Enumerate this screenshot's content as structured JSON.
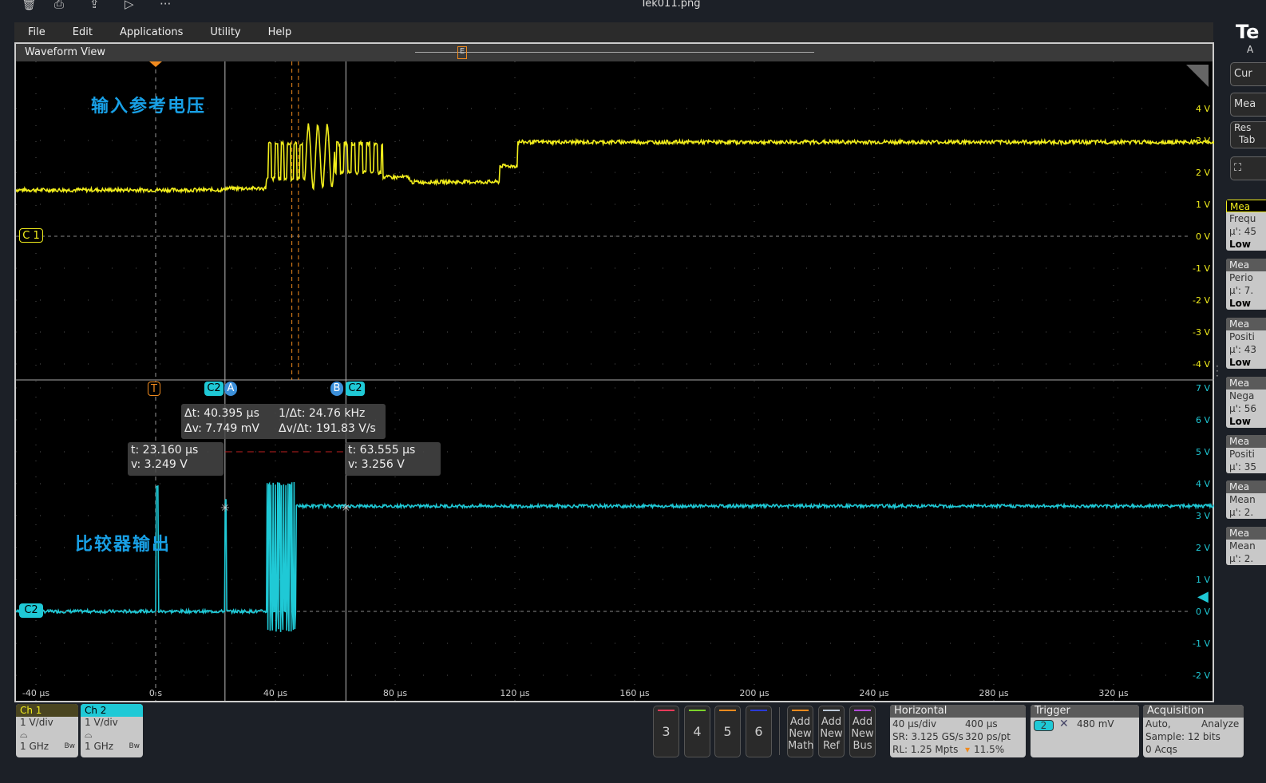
{
  "window": {
    "title": "Tek011.png",
    "toolbar_icons": [
      "trash-icon",
      "print-icon",
      "share-icon",
      "slideshow-icon",
      "more-icon"
    ]
  },
  "menu": [
    "File",
    "Edit",
    "Applications",
    "Utility",
    "Help"
  ],
  "waveform_view": {
    "title": "Waveform View",
    "upper_yticks": [
      "4 V",
      "3 V",
      "2 V",
      "1 V",
      "0 V",
      "-1 V",
      "-2 V",
      "-3 V",
      "-4 V"
    ],
    "lower_yticks": [
      "7 V",
      "6 V",
      "5 V",
      "4 V",
      "3 V",
      "2 V",
      "1 V",
      "0 V",
      "-1 V",
      "-2 V"
    ],
    "xticks": [
      "-40 µs",
      "0 s",
      "40 µs",
      "80 µs",
      "120 µs",
      "160 µs",
      "200 µs",
      "240 µs",
      "280 µs",
      "320 µs"
    ],
    "annotation_ch1": "输入参考电压",
    "annotation_ch2": "比较器输出",
    "ch1_label": "C 1",
    "ch2_label": "C2",
    "trigger_label": "T",
    "cursor_a": "A",
    "cursor_b": "B",
    "cursor_src": "C2",
    "delta": {
      "dt": "Δt: 40.395 µs",
      "inv_dt": "1/Δt: 24.76 kHz",
      "dv": "Δv: 7.749 mV",
      "dvdt": "Δv/Δt: 191.83 V/s"
    },
    "cursor_a_readout": {
      "t": "t: 23.160 µs",
      "v": "v: 3.249 V"
    },
    "cursor_b_readout": {
      "t": "t: 63.555 µs",
      "v": "v: 3.256 V"
    },
    "colors": {
      "ch1": "#f2ee1c",
      "ch2": "#1fc9d6",
      "trigger": "#f08a1e",
      "cursor": "#3b8fd9"
    }
  },
  "channels": [
    {
      "name": "Ch 1",
      "scale": "1 V/div",
      "bw": "1 GHz",
      "bw_icon": "Bw"
    },
    {
      "name": "Ch 2",
      "scale": "1 V/div",
      "bw": "1 GHz",
      "bw_icon": "Bw"
    }
  ],
  "num_buttons": [
    "3",
    "4",
    "5",
    "6"
  ],
  "add_buttons": [
    {
      "l1": "Add",
      "l2": "New",
      "l3": "Math"
    },
    {
      "l1": "Add",
      "l2": "New",
      "l3": "Ref"
    },
    {
      "l1": "Add",
      "l2": "New",
      "l3": "Bus"
    }
  ],
  "horizontal": {
    "title": "Horizontal",
    "scale": "40 µs/div",
    "duration": "400 µs",
    "sr": "SR: 3.125 GS/s",
    "res": "320 ps/pt",
    "rl": "RL: 1.25 Mpts",
    "pos": "11.5%"
  },
  "trigger": {
    "title": "Trigger",
    "source": "2",
    "level": "480 mV"
  },
  "acquisition": {
    "title": "Acquisition",
    "mode": "Auto,",
    "analyze": "Analyze",
    "sample": "Sample: 12 bits",
    "acqs": "0 Acqs"
  },
  "right_panel": {
    "logo": "Te",
    "sub": "A",
    "buttons": [
      "Cur",
      "Mea",
      "Res",
      "Tab"
    ],
    "cards": [
      {
        "h": "Mea",
        "a": "Frequ",
        "b": "µ': 45",
        "c": "Low"
      },
      {
        "h": "Mea",
        "a": "Perio",
        "b": "µ': 7.",
        "c": "Low"
      },
      {
        "h": "Mea",
        "a": "Positi",
        "b": "µ': 43",
        "c": "Low"
      },
      {
        "h": "Mea",
        "a": "Nega",
        "b": "µ': 56",
        "c": "Low"
      },
      {
        "h": "Mea",
        "a": "Positi",
        "b": "µ': 35"
      },
      {
        "h": "Mea",
        "a": "Mean",
        "b": "µ': 2."
      },
      {
        "h": "Mea",
        "a": "Mean",
        "b": "µ': 2."
      }
    ]
  }
}
